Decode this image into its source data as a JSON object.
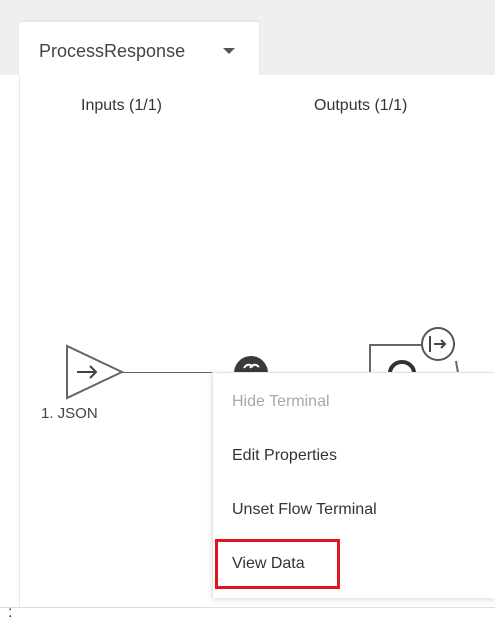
{
  "tab": {
    "title": "ProcessResponse",
    "caret_icon": "caret-down-icon"
  },
  "headers": {
    "inputs": "Inputs (1/1)",
    "outputs": "Outputs (1/1)"
  },
  "input_node": {
    "label": "1. JSON",
    "icon": "arrow-right-icon"
  },
  "output_terminal": {
    "icon": "flow-terminal-icon"
  },
  "context_menu": {
    "items": [
      {
        "label": "Hide Terminal",
        "enabled": false
      },
      {
        "label": "Edit Properties",
        "enabled": true
      },
      {
        "label": "Unset Flow Terminal",
        "enabled": true
      },
      {
        "label": "View Data",
        "enabled": true,
        "highlighted": true
      }
    ]
  },
  "colors": {
    "highlight_border": "#e0161c",
    "node_dark": "#3a3a3a"
  },
  "footer": {
    "mark": ":"
  }
}
